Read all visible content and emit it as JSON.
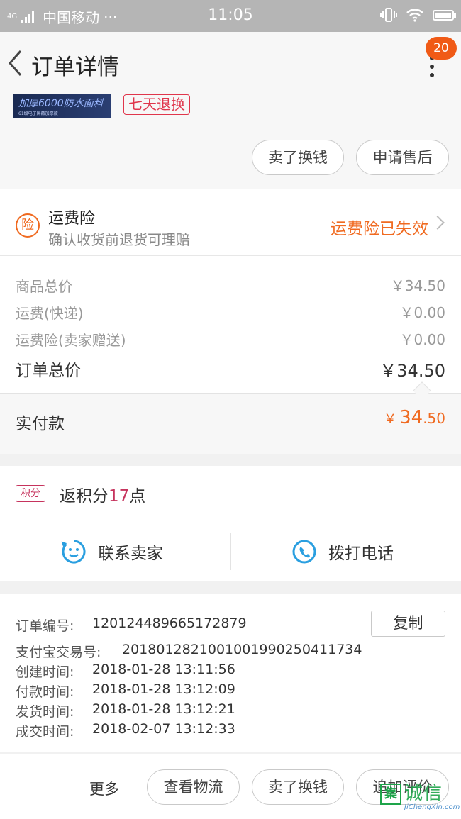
{
  "status_bar": {
    "network": "4G",
    "carrier": "中国移动",
    "dots": "···",
    "time": "11:05"
  },
  "nav": {
    "title": "订单详情",
    "badge_count": "20"
  },
  "product": {
    "image_text": "加厚6000防水面料",
    "image_subtext": "61级电子屏蔽加厚款",
    "tag": "七天退换"
  },
  "product_actions": {
    "sell": "卖了换钱",
    "after_sale": "申请售后"
  },
  "insurance": {
    "icon_char": "险",
    "title": "运费险",
    "subtitle": "确认收货前退货可理赔",
    "status": "运费险已失效"
  },
  "price": {
    "rows": [
      {
        "label": "商品总价",
        "value": "￥34.50"
      },
      {
        "label": "运费(快递)",
        "value": "￥0.00"
      },
      {
        "label": "运费险(卖家赠送)",
        "value": "￥0.00"
      }
    ],
    "total_label": "订单总价",
    "total_value": "￥34.50",
    "paid_label": "实付款",
    "paid_currency": "￥",
    "paid_int": "34",
    "paid_dec": ".50"
  },
  "points": {
    "badge": "积分",
    "prefix": "返积分",
    "value": "17",
    "suffix": "点"
  },
  "contact": {
    "seller": "联系卖家",
    "phone": "拨打电话"
  },
  "order_info": {
    "copy": "复制",
    "rows": [
      {
        "label": "订单编号:",
        "value": "120124489665172879"
      },
      {
        "label": "支付宝交易号:",
        "value": "2018012821001001990250411734"
      },
      {
        "label": "创建时间:",
        "value": "2018-01-28 13:11:56"
      },
      {
        "label": "付款时间:",
        "value": "2018-01-28 13:12:09"
      },
      {
        "label": "发货时间:",
        "value": "2018-01-28 13:12:21"
      },
      {
        "label": "成交时间:",
        "value": "2018-02-07 13:12:33"
      }
    ]
  },
  "footer": {
    "more": "更多",
    "logistics": "查看物流",
    "sell": "卖了换钱",
    "review": "追加评价"
  },
  "watermark": {
    "mark": "集",
    "text": "诚信",
    "url": "JiChengXin.com"
  },
  "colors": {
    "accent": "#f06a20",
    "points": "#c6335d",
    "icon_blue": "#2a9fe0"
  }
}
